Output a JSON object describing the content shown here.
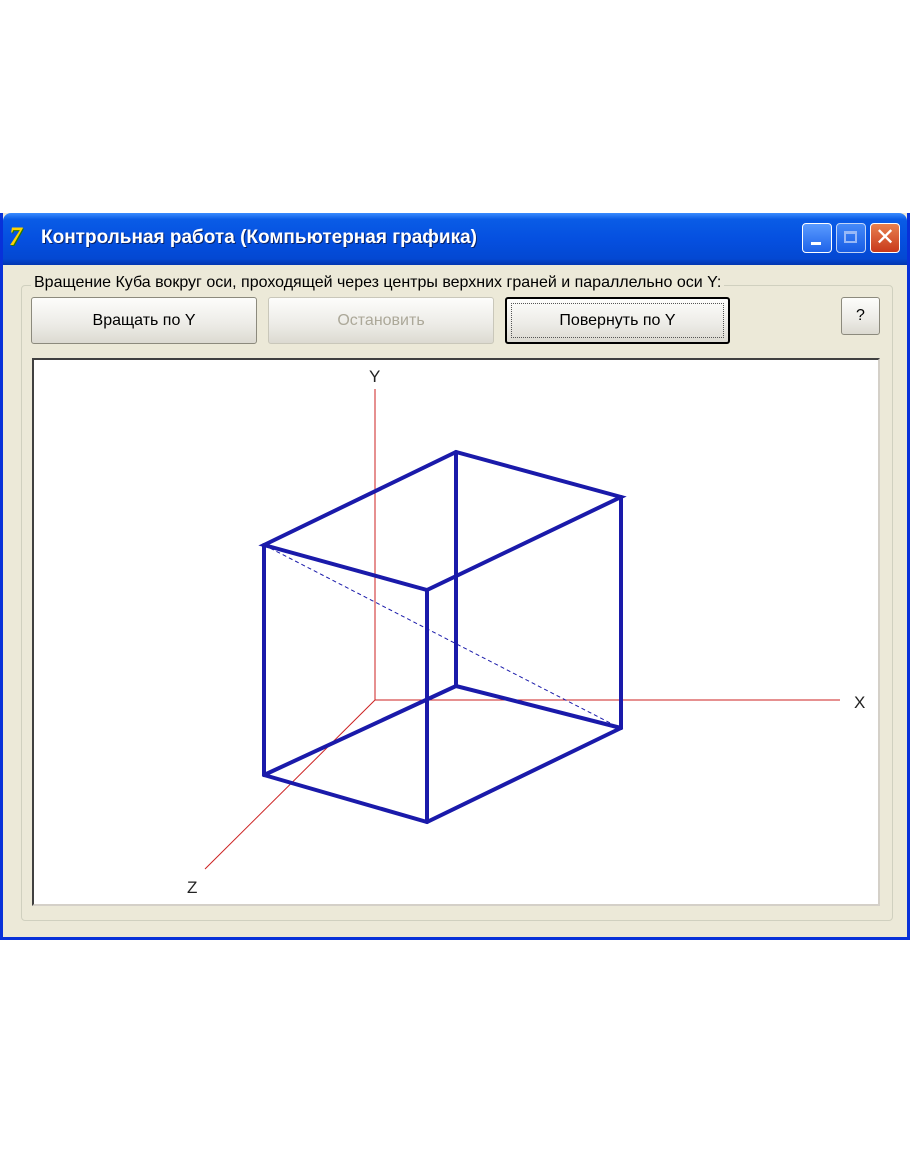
{
  "window": {
    "title": "Контрольная работа (Компьютерная графика)",
    "icon": "app-logo-icon",
    "titlebar_color": "#0550e0"
  },
  "group": {
    "caption": "Вращение Куба вокруг оси, проходящей через центры верхних граней и параллельно оси Y:"
  },
  "buttons": {
    "rotate": "Вращать по Y",
    "stop": "Остановить",
    "turn": "Повернуть по Y",
    "help": "?"
  },
  "states": {
    "stop_enabled": false,
    "turn_focused": true
  },
  "canvas": {
    "axes": {
      "x": "X",
      "y": "Y",
      "z": "Z"
    },
    "axis_color": "#cc2222",
    "cube_color": "#1a1aaa"
  }
}
